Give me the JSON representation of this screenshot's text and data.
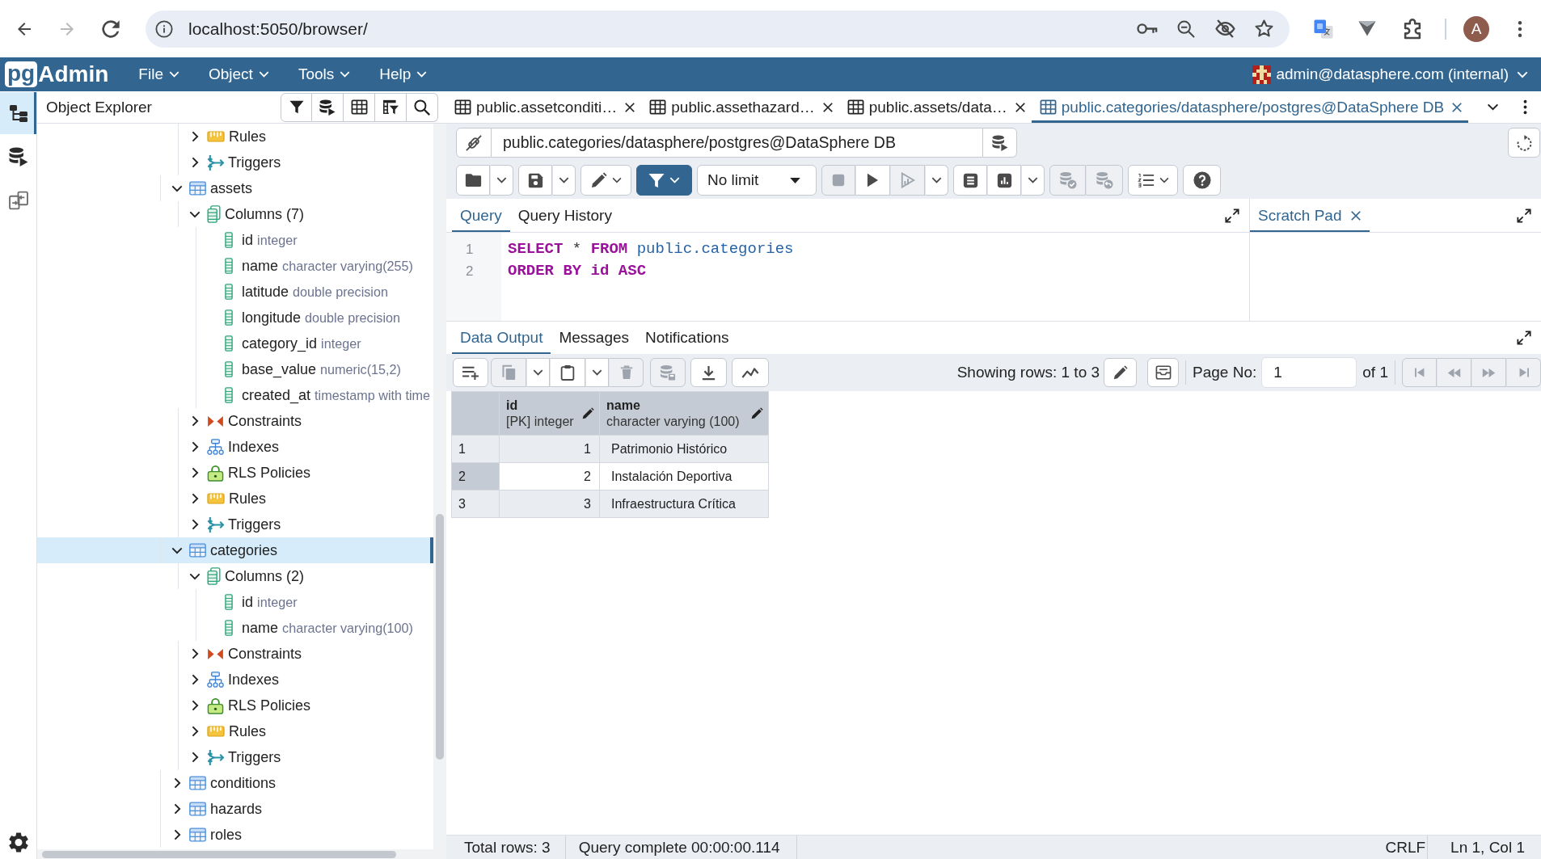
{
  "browser": {
    "nav": [
      {
        "kind": "back",
        "disabled": false
      },
      {
        "kind": "forward",
        "disabled": true
      },
      {
        "kind": "reload",
        "disabled": false
      }
    ],
    "url": "localhost:5050/browser/",
    "profile_initial": "A"
  },
  "app_bar": {
    "logo": {
      "mark": "pg",
      "name": "Admin"
    },
    "menus": [
      "File",
      "Object",
      "Tools",
      "Help"
    ],
    "user": "admin@datasphere.com (internal)"
  },
  "side_rail": [
    {
      "kind": "object_explorer",
      "selected": true
    },
    {
      "kind": "query_workspace",
      "selected": false
    },
    {
      "kind": "schema_diff",
      "selected": false
    }
  ],
  "object_explorer": {
    "title": "Object Explorer",
    "tree": [
      {
        "children": [
          {
            "kind": "rules",
            "label": "Rules",
            "expanded": false,
            "selected": false
          },
          {
            "kind": "triggers",
            "label": "Triggers",
            "expanded": false,
            "selected": false
          }
        ]
      },
      {
        "kind": "table",
        "label": "assets",
        "expanded": true,
        "selected": false,
        "children": [
          {
            "kind": "columns",
            "label": "Columns (7)",
            "expanded": true,
            "selected": false,
            "children": [
              {
                "kind": "column",
                "label": "id",
                "type": "integer",
                "selected": false
              },
              {
                "kind": "column",
                "label": "name",
                "type": "character varying(255)",
                "selected": false
              },
              {
                "kind": "column",
                "label": "latitude",
                "type": "double precision",
                "selected": false
              },
              {
                "kind": "column",
                "label": "longitude",
                "type": "double precision",
                "selected": false
              },
              {
                "kind": "column",
                "label": "category_id",
                "type": "integer",
                "selected": false
              },
              {
                "kind": "column",
                "label": "base_value",
                "type": "numeric(15,2)",
                "selected": false
              },
              {
                "kind": "column",
                "label": "created_at",
                "type": "timestamp with time",
                "selected": false
              }
            ]
          },
          {
            "kind": "constraints",
            "label": "Constraints",
            "expanded": false,
            "selected": false
          },
          {
            "kind": "indexes",
            "label": "Indexes",
            "expanded": false,
            "selected": false
          },
          {
            "kind": "rls_policies",
            "label": "RLS Policies",
            "expanded": false,
            "selected": false
          },
          {
            "kind": "rules",
            "label": "Rules",
            "expanded": false,
            "selected": false
          },
          {
            "kind": "triggers",
            "label": "Triggers",
            "expanded": false,
            "selected": false
          }
        ]
      },
      {
        "kind": "table",
        "label": "categories",
        "expanded": true,
        "selected": true,
        "children": [
          {
            "kind": "columns",
            "label": "Columns (2)",
            "expanded": true,
            "selected": false,
            "children": [
              {
                "kind": "column",
                "label": "id",
                "type": "integer",
                "selected": false
              },
              {
                "kind": "column",
                "label": "name",
                "type": "character varying(100)",
                "selected": false
              }
            ]
          },
          {
            "kind": "constraints",
            "label": "Constraints",
            "expanded": false,
            "selected": false
          },
          {
            "kind": "indexes",
            "label": "Indexes",
            "expanded": false,
            "selected": false
          },
          {
            "kind": "rls_policies",
            "label": "RLS Policies",
            "expanded": false,
            "selected": false
          },
          {
            "kind": "rules",
            "label": "Rules",
            "expanded": false,
            "selected": false
          },
          {
            "kind": "triggers",
            "label": "Triggers",
            "expanded": false,
            "selected": false
          }
        ]
      },
      {
        "kind": "table",
        "label": "conditions",
        "expanded": false,
        "selected": false
      },
      {
        "kind": "table",
        "label": "hazards",
        "expanded": false,
        "selected": false
      },
      {
        "kind": "table",
        "label": "roles",
        "expanded": false,
        "selected": false
      }
    ]
  },
  "editor_tabs": [
    {
      "label": "public.assetconditi…",
      "selected": false
    },
    {
      "label": "public.assethazard…",
      "selected": false
    },
    {
      "label": "public.assets/data…",
      "selected": false
    },
    {
      "label": "public.categories/datasphere/postgres@DataSphere DB",
      "selected": true
    }
  ],
  "connection": "public.categories/datasphere/postgres@DataSphere DB",
  "query_toolbar": [
    {
      "buttons": [
        {
          "kind": "open_file",
          "disabled": false
        },
        {
          "kind": "dropdown",
          "disabled": false
        }
      ]
    },
    {
      "buttons": [
        {
          "kind": "save_file",
          "disabled": false
        },
        {
          "kind": "dropdown",
          "disabled": false
        }
      ]
    },
    {
      "buttons": [
        {
          "kind": "edit_menu",
          "disabled": false
        }
      ]
    },
    {
      "buttons": [
        {
          "kind": "filter_menu",
          "disabled": false
        }
      ]
    },
    {
      "buttons": [
        {
          "kind": "row_limit",
          "value": "No limit"
        }
      ]
    },
    {
      "buttons": [
        {
          "kind": "stop",
          "disabled": true
        },
        {
          "kind": "execute",
          "disabled": false
        },
        {
          "kind": "explain_analyze",
          "disabled": true
        },
        {
          "kind": "dropdown",
          "disabled": false
        }
      ]
    },
    {
      "buttons": [
        {
          "kind": "explain",
          "disabled": false
        },
        {
          "kind": "visualise",
          "disabled": false
        },
        {
          "kind": "dropdown",
          "disabled": false
        }
      ]
    },
    {
      "buttons": [
        {
          "kind": "commit",
          "disabled": true
        },
        {
          "kind": "rollback",
          "disabled": true
        }
      ]
    },
    {
      "buttons": [
        {
          "kind": "macros_menu",
          "disabled": false
        }
      ]
    },
    {
      "buttons": [
        {
          "kind": "help",
          "disabled": false
        }
      ]
    }
  ],
  "query_tabs": [
    {
      "label": "Query",
      "selected": true
    },
    {
      "label": "Query History",
      "selected": false
    }
  ],
  "scratch_tabs": [
    {
      "label": "Scratch Pad",
      "selected": true
    }
  ],
  "editor": {
    "lines": [
      {
        "number": "1",
        "tokens": [
          {
            "kind": "keyword",
            "text": "SELECT"
          },
          {
            "kind": "operator",
            "text": "*"
          },
          {
            "kind": "keyword",
            "text": "FROM"
          },
          {
            "kind": "identifier",
            "text": "public.categories"
          }
        ]
      },
      {
        "number": "2",
        "tokens": [
          {
            "kind": "keyword",
            "text": "ORDER BY id ASC"
          }
        ]
      }
    ]
  },
  "result_tabs": [
    {
      "label": "Data Output",
      "selected": true
    },
    {
      "label": "Messages",
      "selected": false
    },
    {
      "label": "Notifications",
      "selected": false
    }
  ],
  "data_toolbar": {
    "groups": [
      {
        "buttons": [
          {
            "kind": "add_row",
            "disabled": false
          }
        ]
      },
      {
        "buttons": [
          {
            "kind": "copy",
            "disabled": true
          },
          {
            "kind": "dropdown",
            "disabled": false
          },
          {
            "kind": "paste",
            "disabled": false
          },
          {
            "kind": "dropdown",
            "disabled": false
          },
          {
            "kind": "delete",
            "disabled": true
          }
        ]
      },
      {
        "buttons": [
          {
            "kind": "save_data",
            "disabled": true
          }
        ]
      },
      {
        "buttons": [
          {
            "kind": "download",
            "disabled": false
          }
        ]
      },
      {
        "buttons": [
          {
            "kind": "graph",
            "disabled": false
          }
        ]
      }
    ],
    "rows_info": "Showing rows: 1 to 3",
    "page_label": "Page No:",
    "page_value": "1",
    "page_total": "of 1",
    "pager": [
      {
        "kind": "first",
        "disabled": true
      },
      {
        "kind": "previous",
        "disabled": true
      },
      {
        "kind": "next",
        "disabled": true
      },
      {
        "kind": "last",
        "disabled": true
      }
    ]
  },
  "table": {
    "columns": [
      {
        "name": "id",
        "type": "[PK] integer",
        "kind": "number"
      },
      {
        "name": "name",
        "type": "character varying (100)",
        "kind": "text"
      }
    ],
    "rows": [
      {
        "number": "1",
        "cells": [
          "1",
          "Patrimonio Histórico"
        ]
      },
      {
        "number": "2",
        "cells": [
          "2",
          "Instalación Deportiva"
        ]
      },
      {
        "number": "3",
        "cells": [
          "3",
          "Infraestructura Crítica"
        ]
      }
    ]
  },
  "status_bar": {
    "total_rows": "Total rows: 3",
    "query_status": "Query complete 00:00:00.114",
    "line_ending": "CRLF",
    "cursor": "Ln 1, Col 1"
  }
}
